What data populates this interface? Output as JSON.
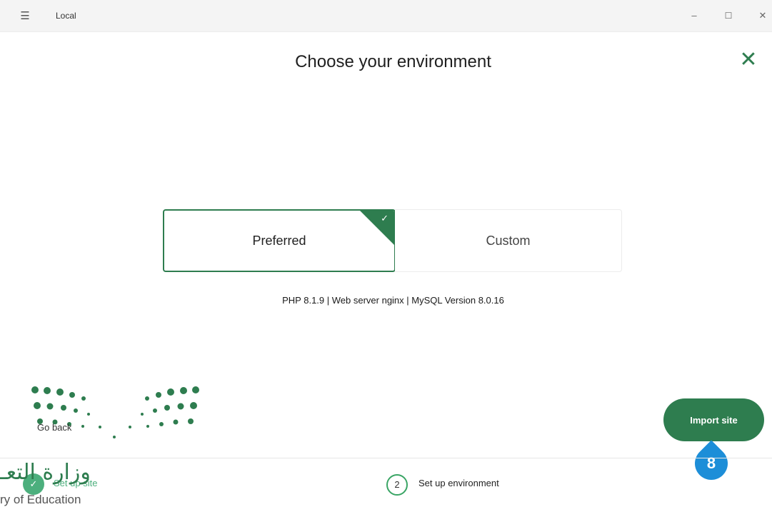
{
  "window": {
    "title": "Local",
    "menu_icon": "hamburger-icon",
    "minimize_glyph": "–",
    "maximize_glyph": "☐",
    "close_glyph": "✕"
  },
  "main": {
    "heading": "Choose your environment",
    "close_glyph": "✕",
    "options": [
      {
        "label": "Preferred",
        "selected": true,
        "check_glyph": "✓"
      },
      {
        "label": "Custom",
        "selected": false
      }
    ],
    "specs": "PHP 8.1.9 | Web server nginx | MySQL Version 8.0.16"
  },
  "actions": {
    "back_label": "Go back",
    "import_label": "Import site",
    "step_marker": "8"
  },
  "steps": [
    {
      "number": "✓",
      "label": "Set up site",
      "completed": true
    },
    {
      "number": "2",
      "label": "Set up environment",
      "completed": false
    }
  ],
  "watermark": {
    "arabic_text": "وزارة التعـ",
    "english_text": "ry of Education"
  },
  "colors": {
    "accent": "#2e7d4f",
    "marker": "#1d8ed8",
    "completed_step": "#4caf7d"
  }
}
